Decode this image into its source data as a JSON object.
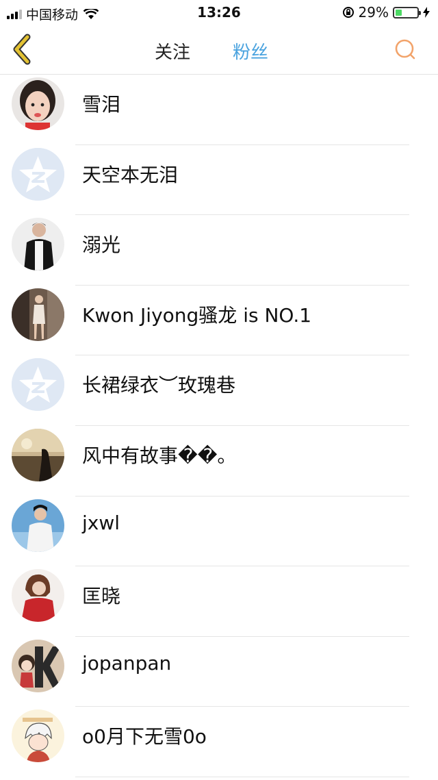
{
  "status_bar": {
    "carrier": "中国移动",
    "time": "13:26",
    "battery_percent": "29%",
    "battery_level": 0.29
  },
  "nav": {
    "tabs": [
      "关注",
      "粉丝"
    ],
    "active_tab": "粉丝",
    "back_icon": "chevron-left-icon",
    "search_icon": "search-icon"
  },
  "colors": {
    "active_tab": "#4aa3df",
    "back_icon": "#e3c233",
    "search_icon": "#f2a36a"
  },
  "fans": [
    {
      "name": "雪泪",
      "avatar": "photo-girl"
    },
    {
      "name": "天空本无泪",
      "avatar": "default-qzone"
    },
    {
      "name": "溺光",
      "avatar": "photo-man-suit"
    },
    {
      "name": "Kwon Jiyong骚龙 is NO.1",
      "avatar": "photo-woman-room"
    },
    {
      "name": "长裙绿衣︶玫瑰巷",
      "avatar": "default-qzone"
    },
    {
      "name": "风中有故事��。",
      "avatar": "photo-sunset-field"
    },
    {
      "name": "jxwl",
      "avatar": "photo-boy-sky"
    },
    {
      "name": "匡晓",
      "avatar": "photo-woman-red"
    },
    {
      "name": "jopanpan",
      "avatar": "cartoon-letter-k"
    },
    {
      "name": "o0月下无雪0o",
      "avatar": "cartoon-anime-boy"
    }
  ]
}
